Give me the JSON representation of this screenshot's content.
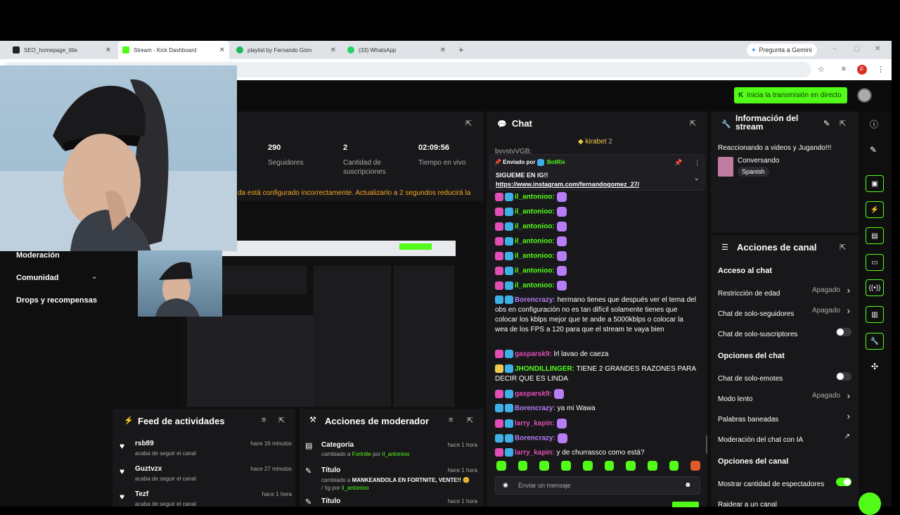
{
  "browser": {
    "tabs": [
      {
        "label": "SEO_homepage_title",
        "icon_color": "#222222"
      },
      {
        "label": "Stream - Kick Dashboard",
        "icon_color": "#53fc18"
      },
      {
        "label": "playlist by Fernando Góm",
        "icon_color": "#1db954"
      },
      {
        "label": "(33) WhatsApp",
        "icon_color": "#25d366"
      }
    ],
    "new_tab": "+",
    "gemini": "Pregunta a Gemini",
    "profile_letter": "F"
  },
  "header": {
    "go_live": "Inicia la transmisión en directo"
  },
  "stats": {
    "followers_value": "290",
    "followers_label": "Seguidores",
    "subs_value": "2",
    "subs_label": "Cantidad de suscripciones",
    "uptime_value": "02:09:56",
    "uptime_label": "Tiempo en vivo",
    "warning": "da está configurado incorrectamente. Actualizarlo a 2 segundos reducirá la"
  },
  "sidebar": {
    "items": [
      {
        "label": "Moderación"
      },
      {
        "label": "Comunidad"
      },
      {
        "label": "Drops y recompensas"
      }
    ]
  },
  "activity_feed": {
    "title": "Feed de actividades",
    "items": [
      {
        "name": "rsb89",
        "time": "hace 16 minutos",
        "desc": "acaba de seguir el canal"
      },
      {
        "name": "Guztvzx",
        "time": "hace 27 minutos",
        "desc": "acaba de seguir el canal"
      },
      {
        "name": "Tezf",
        "time": "hace 1 hora",
        "desc": "acaba de seguir el canal"
      }
    ]
  },
  "mod_actions": {
    "title": "Acciones de moderador",
    "items": [
      {
        "title": "Categoría",
        "time": "hace 1 hora",
        "pre": "cambiado a ",
        "value": "Fortnite",
        "mid": " por ",
        "user": "il_antonioo"
      },
      {
        "title": "Título",
        "time": "hace 1 hora",
        "pre": "cambiado a ",
        "value": "MANKEANDOLA EN FORTNITE, VENTE!! 😊",
        "mid": " / !ig por ",
        "user": "il_antonioo"
      },
      {
        "title": "Título",
        "time": "hace 1 hora",
        "pre": "",
        "value": "",
        "mid": "",
        "user": ""
      }
    ]
  },
  "chat": {
    "title": "Chat",
    "top_gifter": "kirabet",
    "top_gifter_count": "2",
    "scroll_user": "bvvstvVGB:",
    "pinned": {
      "sent_by": "Enviado por",
      "bot": "BotRix",
      "line1": "SIGUEME EN IG!!",
      "line2": "https://www.instagram.com/fernandogomez_27/"
    },
    "messages": [
      {
        "user": "il_antonioo:",
        "color": "#53fc18",
        "text": "",
        "emote": true,
        "badge": "#e04fb5"
      },
      {
        "user": "il_antonioo:",
        "color": "#53fc18",
        "text": "",
        "emote": true,
        "badge": "#e04fb5"
      },
      {
        "user": "il_antonioo:",
        "color": "#53fc18",
        "text": "",
        "emote": true,
        "badge": "#e04fb5"
      },
      {
        "user": "il_antonioo:",
        "color": "#53fc18",
        "text": "",
        "emote": true,
        "badge": "#e04fb5"
      },
      {
        "user": "il_antonioo:",
        "color": "#53fc18",
        "text": "",
        "emote": true,
        "badge": "#e04fb5"
      },
      {
        "user": "il_antonioo:",
        "color": "#53fc18",
        "text": "",
        "emote": true,
        "badge": "#e04fb5"
      },
      {
        "user": "il_antonioo:",
        "color": "#53fc18",
        "text": "",
        "emote": true,
        "badge": "#e04fb5"
      },
      {
        "user": "Borencrazy:",
        "color": "#b77df5",
        "text": " hermano tienes que después ver el tema del obs en configuración no es tan difícil solamente tienes que colocar los kblps mejor que te ande a 5000kblps o colocar la wea de los FPS a 120 para que el stream te vaya bien",
        "emote": false,
        "badge": "#3fb0e6"
      },
      {
        "user": "gasparsk9:",
        "color": "#e04fb5",
        "text": " lrl lavao de caeza",
        "emote": false,
        "badge": "#e04fb5"
      },
      {
        "user": "JHONDILLINGER:",
        "color": "#53fc18",
        "text": " TIENE 2 GRANDES RAZONES PARA DECIR QUE ES LINDA",
        "emote": false,
        "badge": "#f2c94c"
      },
      {
        "user": "gasparsk9:",
        "color": "#e04fb5",
        "text": "",
        "emote": true,
        "badge": "#e04fb5"
      },
      {
        "user": "Borencrazy:",
        "color": "#b77df5",
        "text": " ya mi Wawa",
        "emote": false,
        "badge": "#3fb0e6"
      },
      {
        "user": "larry_kapin:",
        "color": "#e04fb5",
        "text": "",
        "emote": true,
        "badge": "#e04fb5"
      },
      {
        "user": "Borencrazy:",
        "color": "#b77df5",
        "text": "",
        "emote": true,
        "badge": "#3fb0e6"
      },
      {
        "user": "larry_kapin:",
        "color": "#e04fb5",
        "text": " y de churrassco como está?",
        "emote": false,
        "badge": "#e04fb5"
      }
    ],
    "input_placeholder": "Enviar un mensaje"
  },
  "stream_info": {
    "title": "Información del stream",
    "stream_title": "Reaccionando a videos y Jugando!!!",
    "category": "Conversando",
    "language": "Spanish"
  },
  "channel_actions": {
    "title": "Acciones de canal",
    "sections": [
      {
        "heading": "Acceso al chat",
        "rows": [
          {
            "label": "Restricción de edad",
            "value": "Apagado",
            "kind": "chevron"
          },
          {
            "label": "Chat de solo-seguidores",
            "value": "Apagado",
            "kind": "chevron"
          },
          {
            "label": "Chat de solo-suscriptores",
            "value": "",
            "kind": "toggle-off"
          }
        ]
      },
      {
        "heading": "Opciones del chat",
        "rows": [
          {
            "label": "Chat de solo-emotes",
            "value": "",
            "kind": "toggle-off"
          },
          {
            "label": "Modo lento",
            "value": "Apagado",
            "kind": "chevron"
          },
          {
            "label": "Palabras baneadas",
            "value": "",
            "kind": "chevron"
          },
          {
            "label": "Moderación del chat con IA",
            "value": "",
            "kind": "external"
          }
        ]
      },
      {
        "heading": "Opciones del canal",
        "rows": [
          {
            "label": "Mostrar cantidad de espectadores",
            "value": "",
            "kind": "toggle-on"
          },
          {
            "label": "Raidear a un canal",
            "value": "",
            "kind": "none"
          }
        ]
      }
    ]
  },
  "colors": {
    "accent": "#53fc18",
    "panel": "#18181b",
    "bg": "#0f0f10"
  }
}
